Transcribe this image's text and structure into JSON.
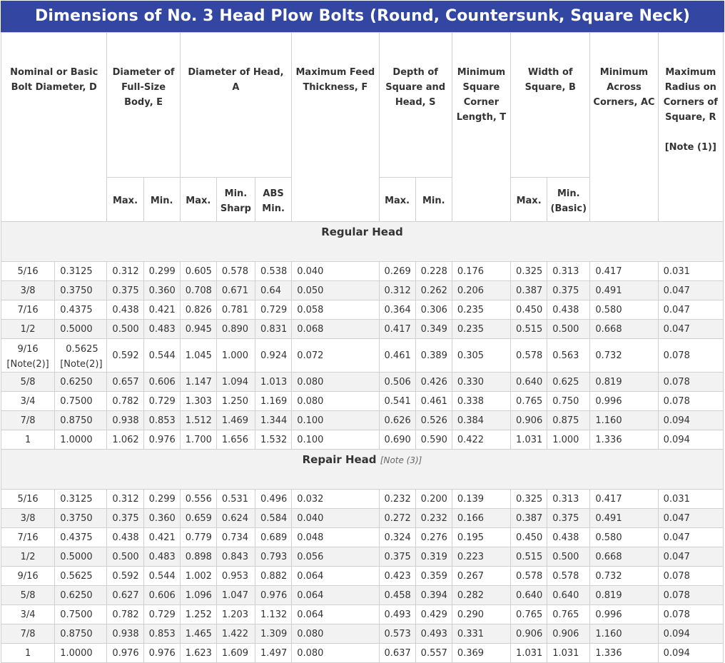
{
  "title": "Dimensions of No. 3 Head Plow Bolts (Round, Countersunk, Square Neck)",
  "headers": {
    "nominal": "Nominal or Basic Bolt Diameter, D",
    "diam_body": "Diameter of Full-Size Body, E",
    "diam_head": "Diameter of  Head, A",
    "max_feed": "Maximum Feed Thickness, F",
    "depth": "Depth of Square and Head, S",
    "min_square": "Minimum Square Corner Length, T",
    "width": "Width of Square, B",
    "min_across": "Minimum Across Corners, AC",
    "max_radius": "Maximum Radius on Corners of Square, R",
    "max_radius_note": "[Note (1)]",
    "max": "Max.",
    "min": "Min.",
    "min_sharp": "Min. Sharp",
    "abs_min": "ABS Min.",
    "min_basic": "Min. (Basic)"
  },
  "sections": {
    "regular": "Regular Head",
    "repair": "Repair Head",
    "repair_note": "[Note (3)]"
  },
  "regular_rows": [
    [
      "5/16",
      "0.3125",
      "0.312",
      "0.299",
      "0.605",
      "0.578",
      "0.538",
      "0.040",
      "0.269",
      "0.228",
      "0.176",
      "0.325",
      "0.313",
      "0.417",
      "0.031"
    ],
    [
      "3/8",
      "0.3750",
      "0.375",
      "0.360",
      "0.708",
      "0.671",
      "0.64",
      "0.050",
      "0.312",
      "0.262",
      "0.206",
      "0.387",
      "0.375",
      "0.491",
      "0.047"
    ],
    [
      "7/16",
      "0.4375",
      "0.438",
      "0.421",
      "0.826",
      "0.781",
      "0.729",
      "0.058",
      "0.364",
      "0.306",
      "0.235",
      "0.450",
      "0.438",
      "0.580",
      "0.047"
    ],
    [
      "1/2",
      "0.5000",
      "0.500",
      "0.483",
      "0.945",
      "0.890",
      "0.831",
      "0.068",
      "0.417",
      "0.349",
      "0.235",
      "0.515",
      "0.500",
      "0.668",
      "0.047"
    ],
    [
      "9/16",
      "0.5625",
      "0.592",
      "0.544",
      "1.045",
      "1.000",
      "0.924",
      "0.072",
      "0.461",
      "0.389",
      "0.305",
      "0.578",
      "0.563",
      "0.732",
      "0.078"
    ],
    [
      "5/8",
      "0.6250",
      "0.657",
      "0.606",
      "1.147",
      "1.094",
      "1.013",
      "0.080",
      "0.506",
      "0.426",
      "0.330",
      "0.640",
      "0.625",
      "0.819",
      "0.078"
    ],
    [
      "3/4",
      "0.7500",
      "0.782",
      "0.729",
      "1.303",
      "1.250",
      "1.169",
      "0.080",
      "0.541",
      "0.461",
      "0.338",
      "0.765",
      "0.750",
      "0.996",
      "0.078"
    ],
    [
      "7/8",
      "0.8750",
      "0.938",
      "0.853",
      "1.512",
      "1.469",
      "1.344",
      "0.100",
      "0.626",
      "0.526",
      "0.384",
      "0.906",
      "0.875",
      "1.160",
      "0.094"
    ],
    [
      "1",
      "1.0000",
      "1.062",
      "0.976",
      "1.700",
      "1.656",
      "1.532",
      "0.100",
      "0.690",
      "0.590",
      "0.422",
      "1.031",
      "1.000",
      "1.336",
      "0.094"
    ]
  ],
  "note2": "[Note(2)]",
  "repair_rows": [
    [
      "5/16",
      "0.3125",
      "0.312",
      "0.299",
      "0.556",
      "0.531",
      "0.496",
      "0.032",
      "0.232",
      "0.200",
      "0.139",
      "0.325",
      "0.313",
      "0.417",
      "0.031"
    ],
    [
      "3/8",
      "0.3750",
      "0.375",
      "0.360",
      "0.659",
      "0.624",
      "0.584",
      "0.040",
      "0.272",
      "0.232",
      "0.166",
      "0.387",
      "0.375",
      "0.491",
      "0.047"
    ],
    [
      "7/16",
      "0.4375",
      "0.438",
      "0.421",
      "0.779",
      "0.734",
      "0.689",
      "0.048",
      "0.324",
      "0.276",
      "0.195",
      "0.450",
      "0.438",
      "0.580",
      "0.047"
    ],
    [
      "1/2",
      "0.5000",
      "0.500",
      "0.483",
      "0.898",
      "0.843",
      "0.793",
      "0.056",
      "0.375",
      "0.319",
      "0.223",
      "0.515",
      "0.500",
      "0.668",
      "0.047"
    ],
    [
      "9/16",
      "0.5625",
      "0.592",
      "0.544",
      "1.002",
      "0.953",
      "0.882",
      "0.064",
      "0.423",
      "0.359",
      "0.267",
      "0.578",
      "0.578",
      "0.732",
      "0.078"
    ],
    [
      "5/8",
      "0.6250",
      "0.627",
      "0.606",
      "1.096",
      "1.047",
      "0.976",
      "0.064",
      "0.458",
      "0.394",
      "0.282",
      "0.640",
      "0.640",
      "0.819",
      "0.078"
    ],
    [
      "3/4",
      "0.7500",
      "0.782",
      "0.729",
      "1.252",
      "1.203",
      "1.132",
      "0.064",
      "0.493",
      "0.429",
      "0.290",
      "0.765",
      "0.765",
      "0.996",
      "0.078"
    ],
    [
      "7/8",
      "0.8750",
      "0.938",
      "0.853",
      "1.465",
      "1.422",
      "1.309",
      "0.080",
      "0.573",
      "0.493",
      "0.331",
      "0.906",
      "0.906",
      "1.160",
      "0.094"
    ],
    [
      "1",
      "1.0000",
      "0.976",
      "0.976",
      "1.623",
      "1.609",
      "1.497",
      "0.080",
      "0.637",
      "0.557",
      "0.369",
      "1.031",
      "1.031",
      "1.336",
      "0.094"
    ]
  ]
}
